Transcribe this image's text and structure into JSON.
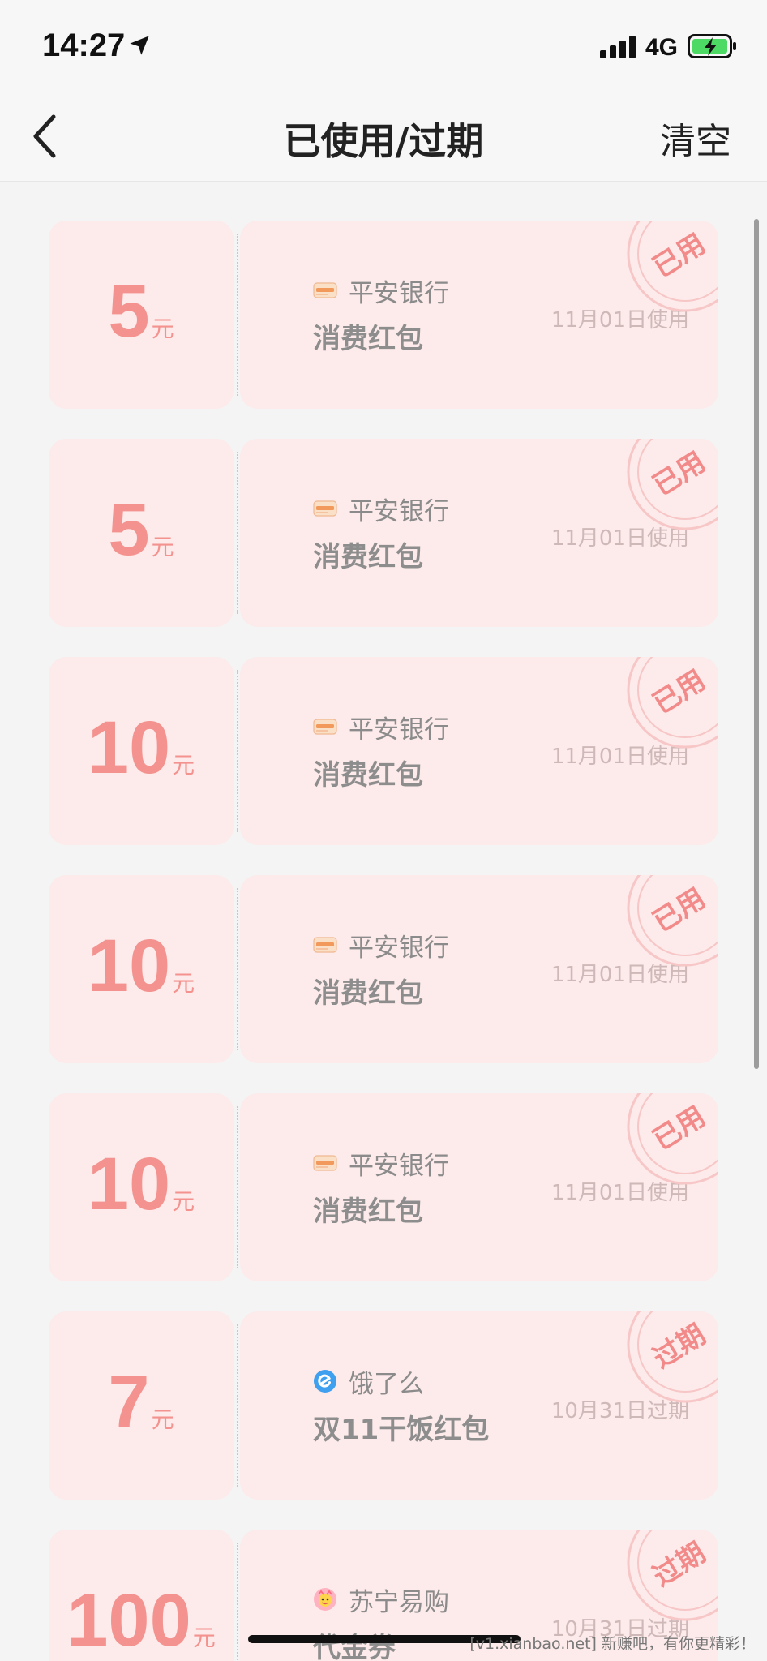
{
  "status_bar": {
    "time": "14:27",
    "network": "4G",
    "battery_charging": true
  },
  "nav": {
    "title": "已使用/过期",
    "clear_label": "清空"
  },
  "coupons": [
    {
      "amount": "5",
      "unit": "元",
      "brand": "平安银行",
      "name": "消费红包",
      "date": "11月01日使用",
      "stamp": "已用",
      "logo": "pingan-bank-logo"
    },
    {
      "amount": "5",
      "unit": "元",
      "brand": "平安银行",
      "name": "消费红包",
      "date": "11月01日使用",
      "stamp": "已用",
      "logo": "pingan-bank-logo"
    },
    {
      "amount": "10",
      "unit": "元",
      "brand": "平安银行",
      "name": "消费红包",
      "date": "11月01日使用",
      "stamp": "已用",
      "logo": "pingan-bank-logo"
    },
    {
      "amount": "10",
      "unit": "元",
      "brand": "平安银行",
      "name": "消费红包",
      "date": "11月01日使用",
      "stamp": "已用",
      "logo": "pingan-bank-logo"
    },
    {
      "amount": "10",
      "unit": "元",
      "brand": "平安银行",
      "name": "消费红包",
      "date": "11月01日使用",
      "stamp": "已用",
      "logo": "pingan-bank-logo"
    },
    {
      "amount": "7",
      "unit": "元",
      "brand": "饿了么",
      "name": "双11干饭红包",
      "date": "10月31日过期",
      "stamp": "过期",
      "logo": "eleme-logo"
    },
    {
      "amount": "100",
      "unit": "元",
      "brand": "苏宁易购",
      "name": "代金券",
      "date": "10月31日过期",
      "stamp": "过期",
      "logo": "suning-logo"
    }
  ],
  "watermark": "[v1.xianbao.net] 新赚吧，有你更精彩！",
  "colors": {
    "coupon_bg": "#fdeaea",
    "amount": "#f3928e",
    "stamp": "#f28a8a"
  }
}
